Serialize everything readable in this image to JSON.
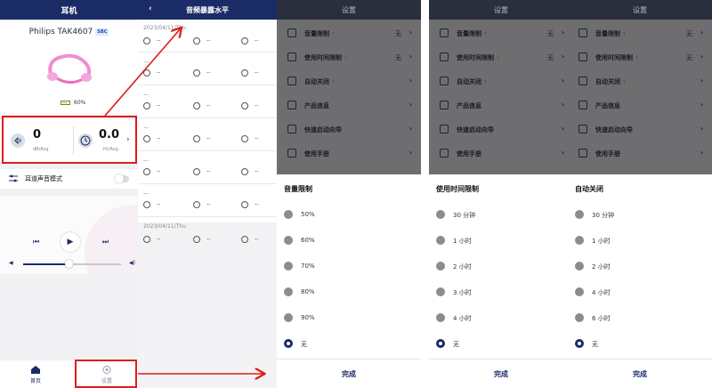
{
  "headphone": {
    "title": "耳机",
    "device_name": "Philips TAK4607",
    "codec": "SBC",
    "battery": "60%",
    "battery_level": 0.6,
    "stat1": {
      "value": "0",
      "unit": "dB/Avg",
      "icon": "ear-sound-icon"
    },
    "stat2": {
      "value": "0.0",
      "unit": "Hr/Avg",
      "icon": "clock-icon"
    },
    "ambient_label": "耳道声音模式",
    "ambient_on": false,
    "volume_level": 0.47,
    "tabs": {
      "home": "首页",
      "settings": "设置"
    }
  },
  "exposure": {
    "title": "音频暴露水平",
    "date1": "2023/04/11/Thu",
    "date2": "2023/04/11/Thu",
    "dash": "--",
    "short_dash": "—"
  },
  "settings": {
    "title": "设置",
    "items": [
      {
        "label": "音量限制",
        "value": "无",
        "help": "?"
      },
      {
        "label": "使用时间限制",
        "value": "无",
        "help": "?"
      },
      {
        "label": "自动关闭",
        "value": "",
        "help": "?"
      },
      {
        "label": "产品信息",
        "value": "",
        "help": ""
      },
      {
        "label": "快速启动向导",
        "value": "",
        "help": ""
      },
      {
        "label": "使用手册",
        "value": "",
        "help": ""
      }
    ],
    "done": "完成"
  },
  "sheet_volume": {
    "title": "音量限制",
    "options": [
      "50%",
      "60%",
      "70%",
      "80%",
      "90%",
      "无"
    ],
    "selected": "无"
  },
  "sheet_usage": {
    "title": "使用时间限制",
    "options": [
      "30 分钟",
      "1 小时",
      "2 小时",
      "3 小时",
      "4 小时",
      "无"
    ],
    "selected": "无"
  },
  "sheet_autooff": {
    "title": "自动关闭",
    "options": [
      "30 分钟",
      "1 小时",
      "2 小时",
      "4 小时",
      "6 小时",
      "无"
    ],
    "selected": "无"
  },
  "colors": {
    "navy": "#1b2b66",
    "annotation_red": "#e01b1b",
    "dim_overlay": "#6e6e70"
  }
}
